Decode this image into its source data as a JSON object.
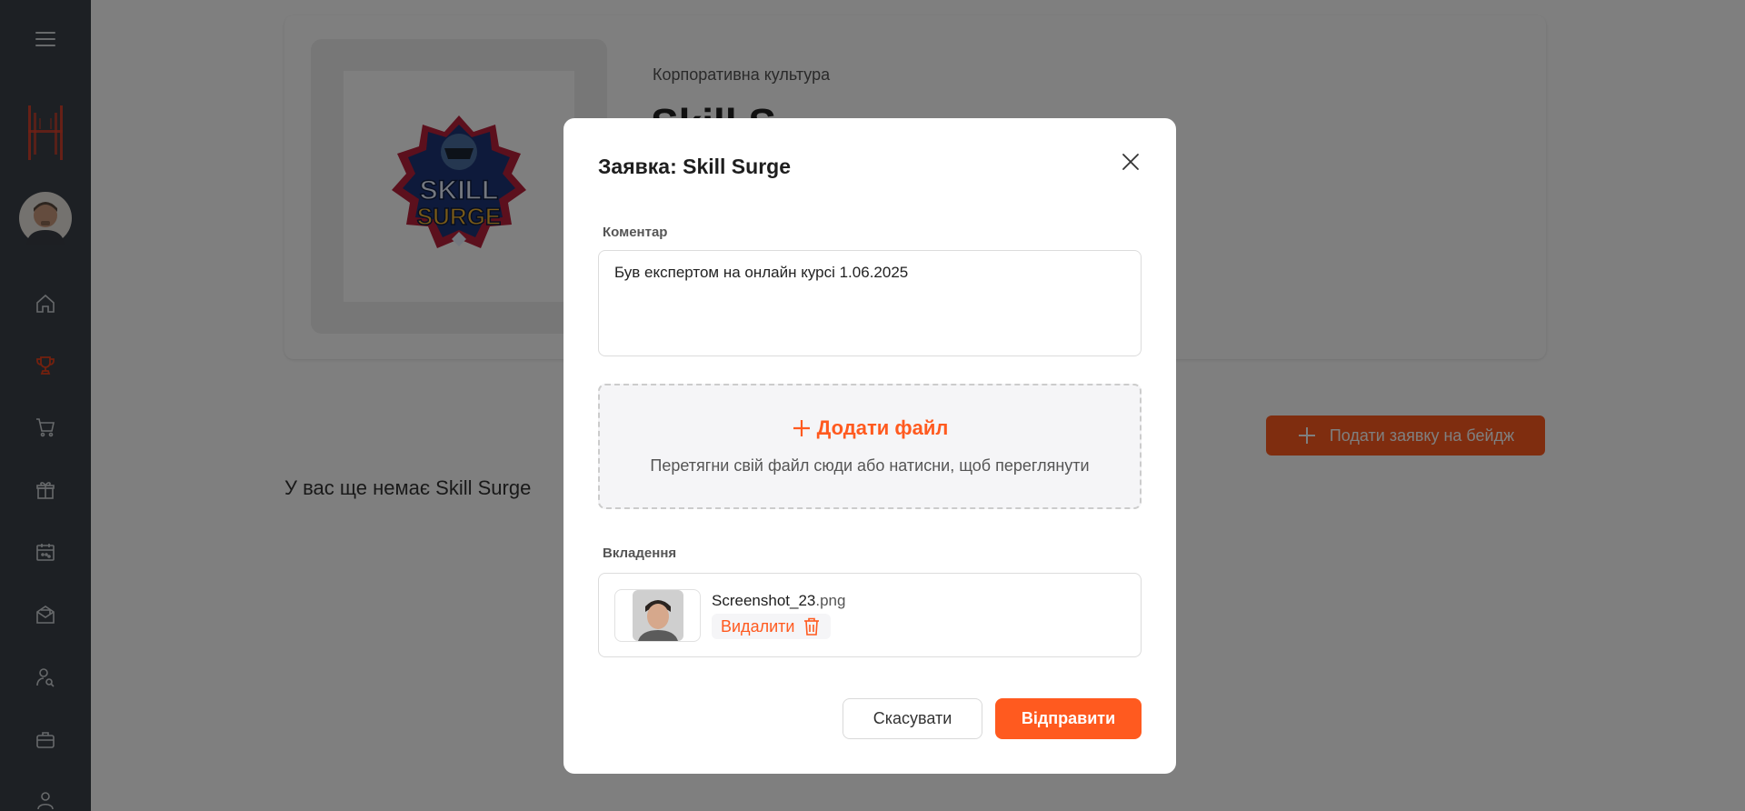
{
  "page": {
    "category": "Корпоративна культура",
    "badge_title": "Skill S",
    "badge_logo_text_top": "SKILL",
    "badge_logo_text_bottom": "SURGE",
    "apply_button": "Подати заявку на бейдж",
    "empty_state": "У вас ще немає Skill Surge"
  },
  "modal": {
    "title": "Заявка: Skill Surge",
    "comment_label": "Коментар",
    "comment_value": "Був експертом на онлайн курсі 1.06.2025",
    "add_file": "Додати файл",
    "dropzone_hint": "Перетягни свій файл сюди або натисни, щоб переглянути",
    "attachments_label": "Вкладення",
    "file_name": "Screenshot_23",
    "file_ext": ".png",
    "delete_label": "Видалити",
    "cancel_label": "Скасувати",
    "submit_label": "Відправити"
  },
  "sidebar": {
    "items": [
      "menu-icon",
      "logo",
      "avatar",
      "home-icon",
      "trophy-icon",
      "cart-icon",
      "gift-icon",
      "calendar-icon",
      "mail-icon",
      "search-person-icon",
      "briefcase-icon",
      "person-icon"
    ]
  },
  "colors": {
    "accent": "#ff5a1f",
    "sidebar": "#3a4148",
    "overlay": "rgba(0,0,0,0.5)"
  }
}
